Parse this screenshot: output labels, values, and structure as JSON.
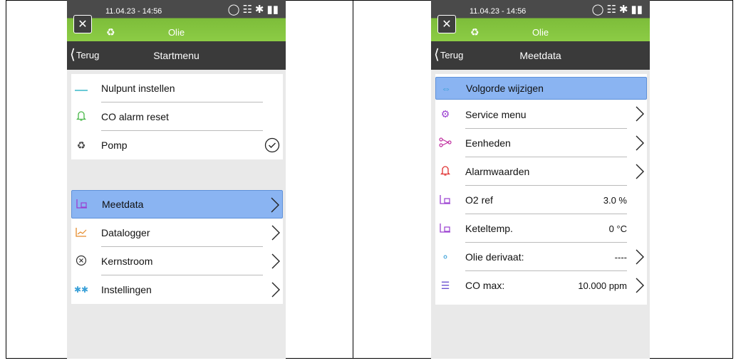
{
  "left": {
    "status": {
      "time": "11.04.23 - 14:56"
    },
    "app_title": "Olie",
    "nav": {
      "back": "Terug",
      "title": "Startmenu"
    },
    "group1": [
      {
        "label": "Nulpunt instellen",
        "icon": "line-icon"
      },
      {
        "label": "CO alarm reset",
        "icon": "bell-icon"
      },
      {
        "label": "Pomp",
        "icon": "pump-icon",
        "control": "check-circle"
      }
    ],
    "group2": [
      {
        "label": "Meetdata",
        "icon": "measure-icon",
        "selected": true
      },
      {
        "label": "Datalogger",
        "icon": "chart-icon"
      },
      {
        "label": "Kernstroom",
        "icon": "x-circle-icon"
      },
      {
        "label": "Instellingen",
        "icon": "gears-icon"
      }
    ]
  },
  "right": {
    "status": {
      "time": "11.04.23 - 14:56"
    },
    "app_title": "Olie",
    "nav": {
      "back": "Terug",
      "title": "Meetdata"
    },
    "items": [
      {
        "label": "Volgorde wijzigen",
        "icon": "swap-icon",
        "selected": true
      },
      {
        "label": "Service menu",
        "icon": "gear-icon"
      },
      {
        "label": "Eenheden",
        "icon": "branch-icon"
      },
      {
        "label": "Alarmwaarden",
        "icon": "bell-icon"
      },
      {
        "label": "O2 ref",
        "icon": "measure-icon",
        "value": "3.0 %"
      },
      {
        "label": "Keteltemp.",
        "icon": "measure-icon",
        "value": "0 °C"
      },
      {
        "label": "Olie derivaat:",
        "icon": "drops-icon",
        "value": "----"
      },
      {
        "label": "CO max:",
        "icon": "list-icon",
        "value": "10.000 ppm"
      }
    ]
  }
}
